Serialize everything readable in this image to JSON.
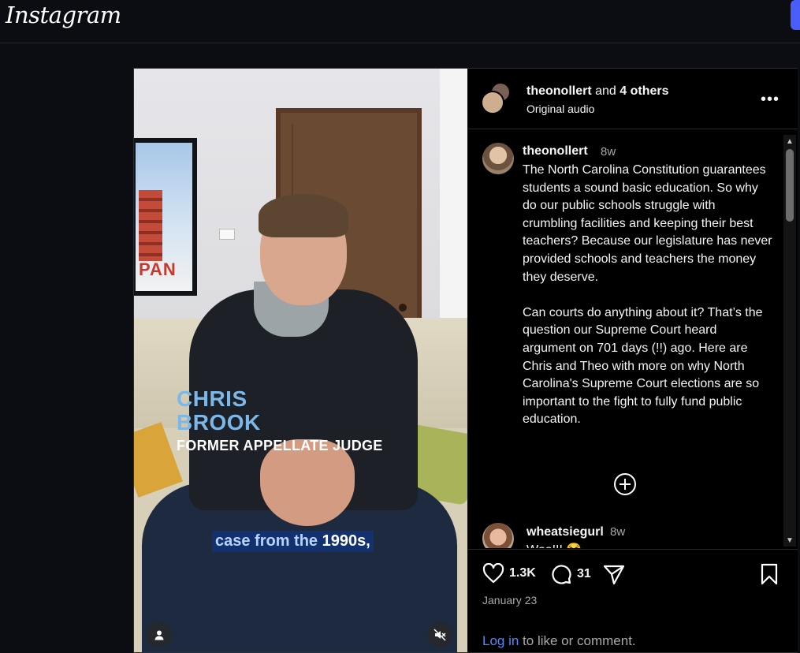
{
  "header": {
    "logo_text": "Instagram"
  },
  "video": {
    "poster_text": "PAN",
    "overlay_name_line1": "CHRIS",
    "overlay_name_line2": "BROOK",
    "overlay_title": "FORMER APPELLATE JUDGE",
    "caption_prefix": "case from the ",
    "caption_highlight": "1990s,",
    "user_icon": "user-icon",
    "mute_icon": "muted-speaker-icon"
  },
  "post_header": {
    "author": "theonollert",
    "and_text": " and ",
    "others": "4 others",
    "audio": "Original audio",
    "more_icon": "more-options-icon"
  },
  "comments": [
    {
      "username": "theonollert",
      "time": "8w",
      "text": "The North Carolina Constitution guarantees students a sound basic education. So why do our public schools struggle with crumbling facilities and keeping their best teachers? Because our legislature has never provided schools and teachers the money they deserve.\n\nCan courts do anything about it? That’s the question our Supreme Court heard argument on 701 days (!!) ago. Here are Chris and Theo with more on why North Carolina's Supreme Court elections are so important to the fight to fully fund public education."
    },
    {
      "username": "wheatsiegurl",
      "time": "8w",
      "text": "Woo!!! 😂"
    }
  ],
  "actions": {
    "like_count": "1.3K",
    "comment_count": "31",
    "date": "January 23",
    "login_link": "Log in",
    "login_suffix": " to like or comment."
  },
  "colors": {
    "accent": "#4f8cf7",
    "background": "#000000",
    "overlay_name": "#7db7e8",
    "caption_bg": "#13316e"
  }
}
